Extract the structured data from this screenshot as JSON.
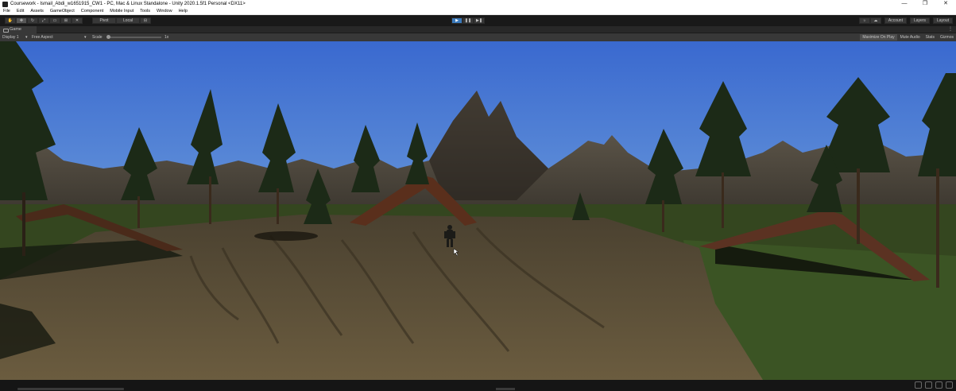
{
  "window": {
    "title": "Coursework - Ismail_Abdi_w1651915_CW1 - PC, Mac & Linux Standalone - Unity 2020.1.5f1 Personal <DX11>",
    "controls": [
      "—",
      "❐",
      "✕"
    ]
  },
  "menubar": [
    "File",
    "Edit",
    "Assets",
    "GameObject",
    "Component",
    "Mobile Input",
    "Tools",
    "Window",
    "Help"
  ],
  "toolbar": {
    "tools": [
      "hand-tool",
      "move-tool",
      "rotate-tool",
      "scale-tool",
      "rect-tool",
      "transform-tool",
      "custom-tool"
    ],
    "pivot_label": "Pivot",
    "local_label": "Local",
    "play_controls": [
      "play-button",
      "pause-button",
      "step-button"
    ],
    "account_label": "Account",
    "layers_label": "Layers",
    "layout_label": "Layout"
  },
  "game_view": {
    "tab_label": "Game",
    "display_label": "Display 1",
    "aspect_label": "Free Aspect",
    "scale_label": "Scale",
    "scale_value": "1x",
    "maximize_label": "Maximize On Play",
    "mute_label": "Mute Audio",
    "stats_label": "Stats",
    "gizmos_label": "Gizmos"
  },
  "colors": {
    "play_active": "#3a79bb",
    "sky_top": "#3f6ed3",
    "grass": "#2e3f1c",
    "dirt": "#54492f"
  }
}
